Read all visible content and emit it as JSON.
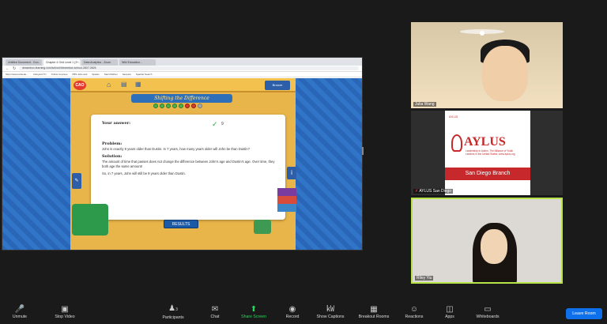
{
  "browser": {
    "tabs": [
      "Untitled Document - Goo...",
      "Chapter 4 Grid Level 1 (3+...",
      "Data Analytics - Zoom",
      "Wiki Education..."
    ],
    "url": "dreambox.learning.com/school/dreambox-school-2807-0826",
    "bookmarks": [
      "https://www.artsedu...",
      "Unfoyard TC",
      "Online Courses",
      "PBS Jobs and",
      "Sparks",
      "Saint Mother",
      "Neopets",
      "Sparkle Search",
      "Timely",
      "Spy Kid"
    ]
  },
  "game": {
    "logo": "CAO",
    "title": "Shifting the Difference",
    "score_label": "Bronze",
    "your_answer_label": "Your answer:",
    "your_answer_value": "9",
    "problem_label": "Problem:",
    "problem_text": "John is exactly 9 years older than Dustin. In 7 years, how many years older will John be than Dustin?",
    "solution_label": "Solution:",
    "solution_text": "The amount of time that passes does not change the difference between John's age and Dustin's age. Over time, they both age the same amount!",
    "conclusion": "So, in 7 years, John will still be 9 years older than Dustin.",
    "results_button": "RESULTS"
  },
  "participants": [
    {
      "name": "Julia Wang"
    },
    {
      "name": "AYLUS San Diego"
    },
    {
      "name": "Riley Yiu"
    }
  ],
  "aylus": {
    "top_small": "AYLUS",
    "brand": "AYLUS",
    "tagline": "Leadership in Action. The Alliance of Youth Leaders in the United States. www.aylus.org",
    "branch": "San Diego Branch"
  },
  "toolbar": {
    "unmute": "Unmute",
    "stop_video": "Stop Video",
    "participants": "Participants",
    "participants_count": "3",
    "chat": "Chat",
    "share_screen": "Share Screen",
    "record": "Record",
    "show_captions": "Show Captions",
    "breakout_rooms": "Breakout Rooms",
    "reactions": "Reactions",
    "apps": "Apps",
    "whiteboards": "Whiteboards",
    "leave_room": "Leave Room"
  },
  "colors": {
    "zoom_bg": "#1a1a1a",
    "leave_blue": "#0e71eb",
    "share_green": "#23d959",
    "active_speaker": "#b7e34a"
  }
}
